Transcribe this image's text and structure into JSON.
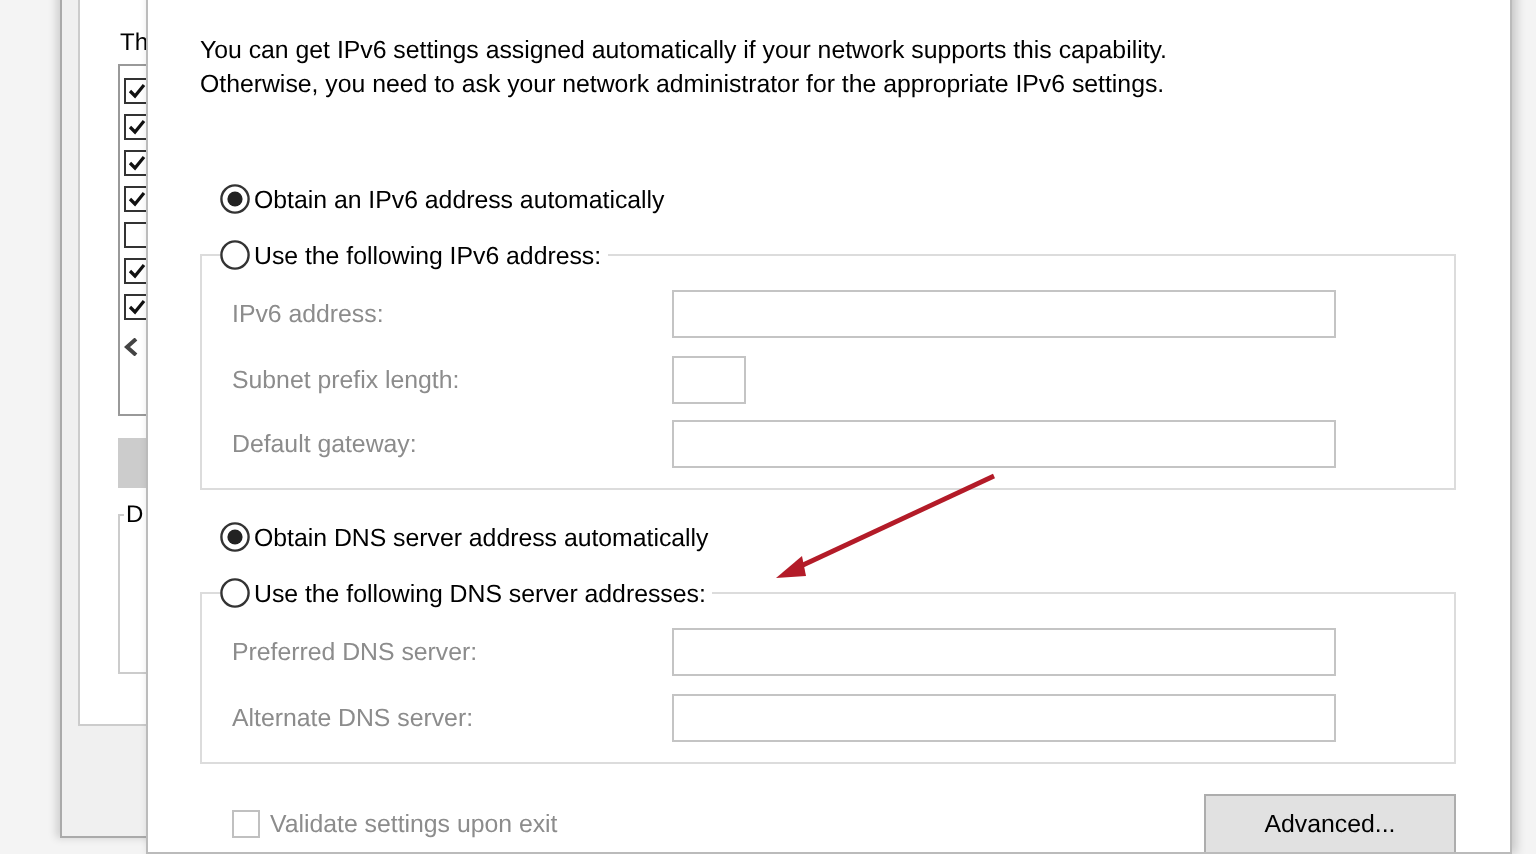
{
  "back_window": {
    "heading": "Th",
    "items": [
      {
        "checked": true
      },
      {
        "checked": true
      },
      {
        "checked": true
      },
      {
        "checked": true
      },
      {
        "checked": false
      },
      {
        "checked": true
      },
      {
        "checked": true
      }
    ],
    "group_label": "D"
  },
  "intro": "You can get IPv6 settings assigned automatically if your network supports this capability.\nOtherwise, you need to ask your network administrator for the appropriate IPv6 settings.",
  "address_mode": [
    {
      "label": "Obtain an IPv6 address automatically",
      "selected": true
    },
    {
      "label": "Use the following IPv6 address:",
      "selected": false
    }
  ],
  "address_fields": [
    {
      "label": "IPv6 address:",
      "kind": "wide",
      "disabled": true
    },
    {
      "label": "Subnet prefix length:",
      "kind": "narrow",
      "disabled": true
    },
    {
      "label": "Default gateway:",
      "kind": "wide",
      "disabled": true
    }
  ],
  "dns_mode": [
    {
      "label": "Obtain DNS server address automatically",
      "selected": true
    },
    {
      "label": "Use the following DNS server addresses:",
      "selected": false
    }
  ],
  "dns_fields": [
    {
      "label": "Preferred DNS server:",
      "kind": "wide",
      "disabled": true
    },
    {
      "label": "Alternate DNS server:",
      "kind": "wide",
      "disabled": true
    }
  ],
  "validate": {
    "label": "Validate settings upon exit",
    "checked": false,
    "disabled": true
  },
  "buttons": [
    {
      "label": "Advanced..."
    }
  ],
  "annotation": {
    "kind": "arrow"
  }
}
